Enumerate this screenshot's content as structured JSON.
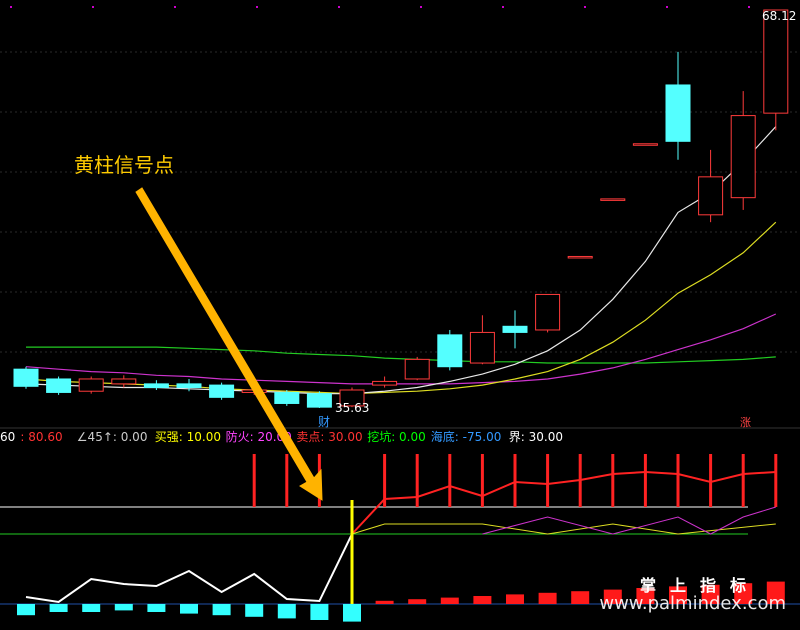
{
  "chart_data": {
    "type": "candlestick",
    "price_panel": {
      "max_label": "68.12",
      "min_label": "35.63",
      "event_marker": "财",
      "corner_marker": "涨",
      "candles": [
        {
          "o": 38.8,
          "c": 37.4,
          "h": 39.0,
          "l": 37.2
        },
        {
          "o": 38.0,
          "c": 36.9,
          "h": 38.2,
          "l": 36.7
        },
        {
          "o": 37.0,
          "c": 38.0,
          "h": 38.2,
          "l": 36.8
        },
        {
          "o": 37.6,
          "c": 38.0,
          "h": 38.3,
          "l": 37.3
        },
        {
          "o": 37.6,
          "c": 37.3,
          "h": 37.9,
          "l": 37.1
        },
        {
          "o": 37.6,
          "c": 37.3,
          "h": 38.0,
          "l": 37.0
        },
        {
          "o": 37.5,
          "c": 36.5,
          "h": 37.7,
          "l": 36.3
        },
        {
          "o": 36.9,
          "c": 37.1,
          "h": 37.3,
          "l": 36.7
        },
        {
          "o": 36.9,
          "c": 36.0,
          "h": 37.1,
          "l": 35.8
        },
        {
          "o": 36.8,
          "c": 35.7,
          "h": 37.0,
          "l": 35.63
        },
        {
          "o": 35.8,
          "c": 37.1,
          "h": 37.3,
          "l": 35.7
        },
        {
          "o": 37.5,
          "c": 37.8,
          "h": 38.2,
          "l": 37.3
        },
        {
          "o": 38.0,
          "c": 39.6,
          "h": 39.8,
          "l": 37.9
        },
        {
          "o": 41.6,
          "c": 39.0,
          "h": 42.0,
          "l": 38.7
        },
        {
          "o": 39.3,
          "c": 41.8,
          "h": 43.2,
          "l": 39.2
        },
        {
          "o": 42.3,
          "c": 41.8,
          "h": 43.6,
          "l": 40.5
        },
        {
          "o": 42.0,
          "c": 44.9,
          "h": 44.9,
          "l": 41.8
        },
        {
          "o": 48.0,
          "c": 48.0,
          "h": 48.0,
          "l": 48.0
        },
        {
          "o": 52.7,
          "c": 52.7,
          "h": 52.7,
          "l": 52.7
        },
        {
          "o": 57.2,
          "c": 57.2,
          "h": 57.2,
          "l": 57.2
        },
        {
          "o": 62.0,
          "c": 57.4,
          "h": 64.7,
          "l": 55.9
        },
        {
          "o": 51.4,
          "c": 54.5,
          "h": 56.7,
          "l": 50.8
        },
        {
          "o": 52.8,
          "c": 59.5,
          "h": 61.5,
          "l": 51.8
        },
        {
          "o": 59.7,
          "c": 68.12,
          "h": 68.12,
          "l": 58.3
        }
      ],
      "ma_white": [
        37.6,
        37.5,
        37.4,
        37.3,
        37.3,
        37.2,
        37.1,
        37.0,
        36.9,
        36.8,
        36.8,
        37.0,
        37.3,
        37.8,
        38.4,
        39.2,
        40.3,
        42.0,
        44.5,
        47.6,
        51.6,
        53.2,
        55.7,
        58.6
      ],
      "ma_yellow": [
        38.0,
        37.8,
        37.7,
        37.6,
        37.5,
        37.4,
        37.2,
        37.1,
        37.0,
        36.9,
        36.8,
        36.9,
        37.0,
        37.2,
        37.5,
        38.0,
        38.6,
        39.6,
        41.0,
        42.8,
        45.0,
        46.5,
        48.3,
        50.8
      ],
      "ma_magenta": [
        39.0,
        38.8,
        38.6,
        38.5,
        38.3,
        38.2,
        38.0,
        37.9,
        37.8,
        37.7,
        37.6,
        37.6,
        37.6,
        37.6,
        37.7,
        37.8,
        38.0,
        38.4,
        38.9,
        39.6,
        40.4,
        41.2,
        42.1,
        43.3
      ],
      "ma_green": [
        40.6,
        40.6,
        40.6,
        40.6,
        40.6,
        40.5,
        40.4,
        40.3,
        40.1,
        40.0,
        39.9,
        39.7,
        39.6,
        39.5,
        39.4,
        39.4,
        39.3,
        39.3,
        39.3,
        39.3,
        39.4,
        39.5,
        39.6,
        39.8
      ]
    },
    "indicator_panel": {
      "legend": [
        {
          "text": "60",
          "color": "#ffffff"
        },
        {
          "text": ": 80.60",
          "color": "#ff3333"
        },
        {
          "text": "∠45↑: 0.00",
          "color": "#cccccc"
        },
        {
          "text": "买强: 10.00",
          "color": "#ffff00"
        },
        {
          "text": "防火: 20.00",
          "color": "#ff44ff"
        },
        {
          "text": "卖点: 30.00",
          "color": "#ff3333"
        },
        {
          "text": "挖坑: 0.00",
          "color": "#00ff00"
        },
        {
          "text": "海底: -75.00",
          "color": "#3399ff"
        },
        {
          "text": "界: 30.00",
          "color": "#ffffff"
        }
      ],
      "ylim": [
        -90,
        70
      ],
      "line_values": [
        -63,
        -68,
        -45,
        -50,
        -52,
        -37,
        -58,
        -40,
        -65,
        -67,
        0,
        35,
        37,
        48,
        38,
        52,
        50,
        54,
        60,
        62,
        60,
        52,
        60,
        62
      ],
      "red_bar_idx": [
        7,
        8,
        9,
        10,
        11,
        12,
        13,
        14,
        15,
        16,
        17,
        18,
        19,
        20,
        21,
        22,
        23
      ],
      "bottom_bars": [
        -7,
        -5,
        -5,
        -4,
        -5,
        -6,
        -7,
        -8,
        -9,
        -10,
        -11,
        2,
        3,
        4,
        5,
        6,
        7,
        8,
        9,
        10,
        11,
        12,
        13,
        14
      ],
      "signal_index": 10,
      "signal_text": "黄柱信号点",
      "watermark": "www.palmindex.com",
      "brand": "掌上指标"
    }
  }
}
